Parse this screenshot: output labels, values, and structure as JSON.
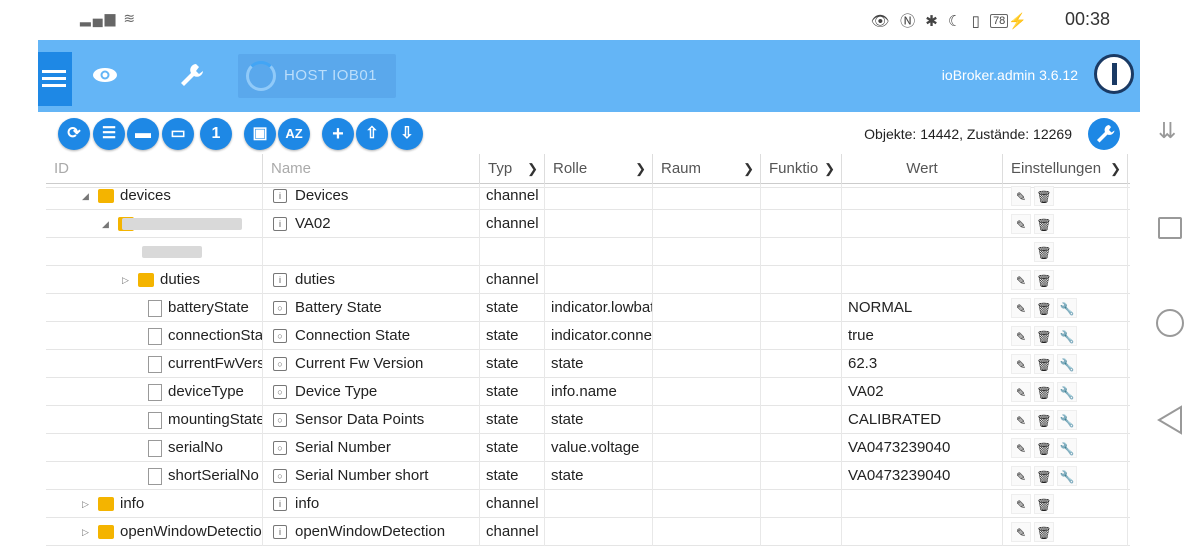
{
  "status": {
    "time": "00:38",
    "battery": "78"
  },
  "app": {
    "host_label": "HOST IOB01",
    "version": "ioBroker.admin 3.6.12",
    "counts": "Objekte: 14442, Zustände: 12269",
    "toolbar_buttons": [
      "refresh-icon",
      "list-icon",
      "folder-icon",
      "folder-open-icon",
      "1",
      "person-icon",
      "AZ",
      "+",
      "upload-icon",
      "download-icon"
    ]
  },
  "columns": {
    "id": "ID",
    "name": "Name",
    "typ": "Typ",
    "rolle": "Rolle",
    "raum": "Raum",
    "funktion": "Funktio",
    "wert": "Wert",
    "einstellungen": "Einstellungen"
  },
  "rows": [
    {
      "id": "devices",
      "name": "Devices",
      "typ": "channel",
      "rolle": "",
      "wert": ""
    },
    {
      "id": "",
      "name": "VA02",
      "typ": "channel",
      "rolle": "",
      "wert": ""
    },
    {
      "id": "",
      "name": "",
      "typ": "",
      "rolle": "",
      "wert": ""
    },
    {
      "id": "duties",
      "name": "duties",
      "typ": "channel",
      "rolle": "",
      "wert": ""
    },
    {
      "id": "batteryState",
      "name": "Battery State",
      "typ": "state",
      "rolle": "indicator.lowbat",
      "wert": "NORMAL"
    },
    {
      "id": "connectionState",
      "name": "Connection State",
      "typ": "state",
      "rolle": "indicator.connected",
      "wert": "true"
    },
    {
      "id": "currentFwVersion",
      "name": "Current Fw Version",
      "typ": "state",
      "rolle": "state",
      "wert": "62.3"
    },
    {
      "id": "deviceType",
      "name": "Device Type",
      "typ": "state",
      "rolle": "info.name",
      "wert": "VA02"
    },
    {
      "id": "mountingState",
      "name": "Sensor Data Points",
      "typ": "state",
      "rolle": "state",
      "wert": "CALIBRATED"
    },
    {
      "id": "serialNo",
      "name": "Serial Number",
      "typ": "state",
      "rolle": "value.voltage",
      "wert": "VA0473239040"
    },
    {
      "id": "shortSerialNo",
      "name": "Serial Number short",
      "typ": "state",
      "rolle": "state",
      "wert": "VA0473239040"
    },
    {
      "id": "info",
      "name": "info",
      "typ": "channel",
      "rolle": "",
      "wert": ""
    },
    {
      "id": "openWindowDetection",
      "name": "openWindowDetection",
      "typ": "channel",
      "rolle": "",
      "wert": ""
    }
  ]
}
